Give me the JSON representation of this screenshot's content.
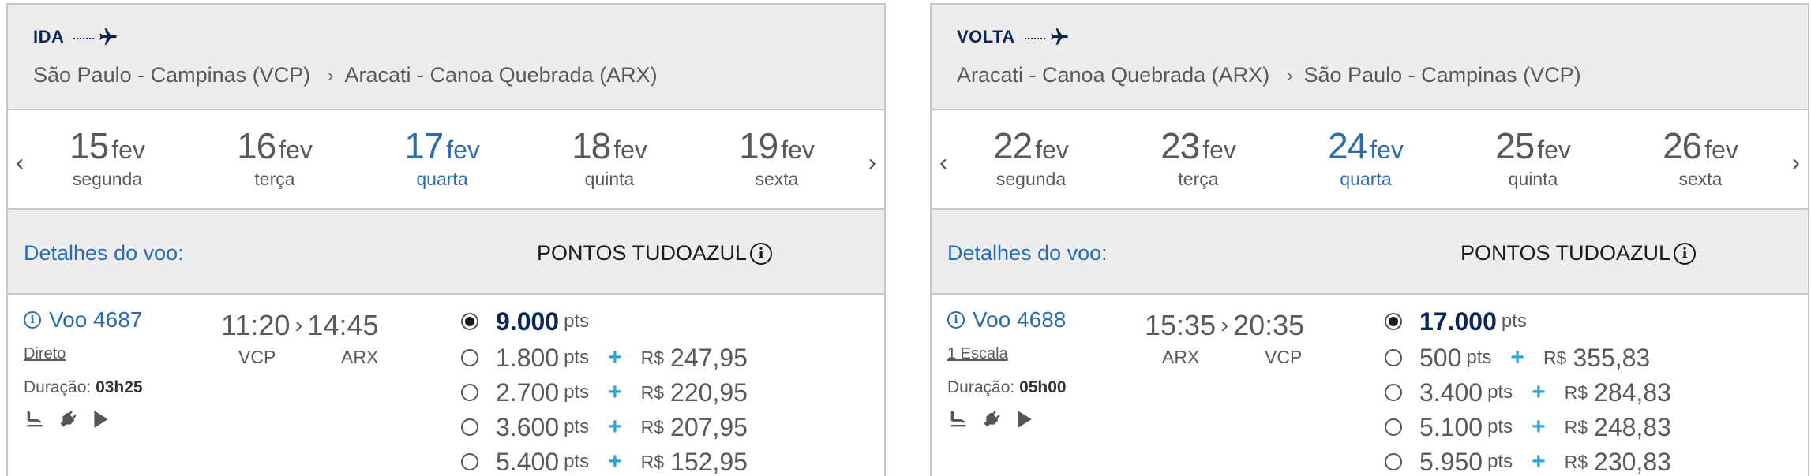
{
  "outbound": {
    "direction": "IDA",
    "origin": "São Paulo - Campinas (VCP)",
    "destination": "Aracati - Canoa Quebrada (ARX)",
    "dates": [
      {
        "day": "15",
        "month": "fev",
        "weekday": "segunda"
      },
      {
        "day": "16",
        "month": "fev",
        "weekday": "terça"
      },
      {
        "day": "17",
        "month": "fev",
        "weekday": "quarta"
      },
      {
        "day": "18",
        "month": "fev",
        "weekday": "quinta"
      },
      {
        "day": "19",
        "month": "fev",
        "weekday": "sexta"
      }
    ],
    "details_label": "Detalhes do voo:",
    "points_label": "PONTOS TUDOAZUL",
    "flight": {
      "number": "Voo 4687",
      "stops": "Direto",
      "duration_label": "Duração:",
      "duration": "03h25",
      "depart_time": "11:20",
      "arrive_time": "14:45",
      "depart_code": "VCP",
      "arrive_code": "ARX"
    },
    "options": [
      {
        "points": "9.000",
        "unit": "pts"
      },
      {
        "points": "1.800",
        "unit": "pts",
        "plus": "+",
        "currency": "R$",
        "money": "247,95"
      },
      {
        "points": "2.700",
        "unit": "pts",
        "plus": "+",
        "currency": "R$",
        "money": "220,95"
      },
      {
        "points": "3.600",
        "unit": "pts",
        "plus": "+",
        "currency": "R$",
        "money": "207,95"
      },
      {
        "points": "5.400",
        "unit": "pts",
        "plus": "+",
        "currency": "R$",
        "money": "152,95"
      }
    ]
  },
  "inbound": {
    "direction": "VOLTA",
    "origin": "Aracati - Canoa Quebrada (ARX)",
    "destination": "São Paulo - Campinas (VCP)",
    "dates": [
      {
        "day": "22",
        "month": "fev",
        "weekday": "segunda"
      },
      {
        "day": "23",
        "month": "fev",
        "weekday": "terça"
      },
      {
        "day": "24",
        "month": "fev",
        "weekday": "quarta"
      },
      {
        "day": "25",
        "month": "fev",
        "weekday": "quinta"
      },
      {
        "day": "26",
        "month": "fev",
        "weekday": "sexta"
      }
    ],
    "details_label": "Detalhes do voo:",
    "points_label": "PONTOS TUDOAZUL",
    "flight": {
      "number": "Voo 4688",
      "stops": "1 Escala",
      "duration_label": "Duração:",
      "duration": "05h00",
      "depart_time": "15:35",
      "arrive_time": "20:35",
      "depart_code": "ARX",
      "arrive_code": "VCP"
    },
    "options": [
      {
        "points": "17.000",
        "unit": "pts"
      },
      {
        "points": "500",
        "unit": "pts",
        "plus": "+",
        "currency": "R$",
        "money": "355,83"
      },
      {
        "points": "3.400",
        "unit": "pts",
        "plus": "+",
        "currency": "R$",
        "money": "284,83"
      },
      {
        "points": "5.100",
        "unit": "pts",
        "plus": "+",
        "currency": "R$",
        "money": "248,83"
      },
      {
        "points": "5.950",
        "unit": "pts",
        "plus": "+",
        "currency": "R$",
        "money": "230,83"
      }
    ]
  },
  "colors": {
    "brand_dark": "#0b2554",
    "link_blue": "#2a6cb0",
    "plus_cyan": "#2aa7d6",
    "header_bg": "#ededed"
  },
  "icons": {
    "plane": "airplane-icon",
    "seat": "seat-icon",
    "power": "power-plug-icon",
    "entertainment": "play-icon"
  }
}
